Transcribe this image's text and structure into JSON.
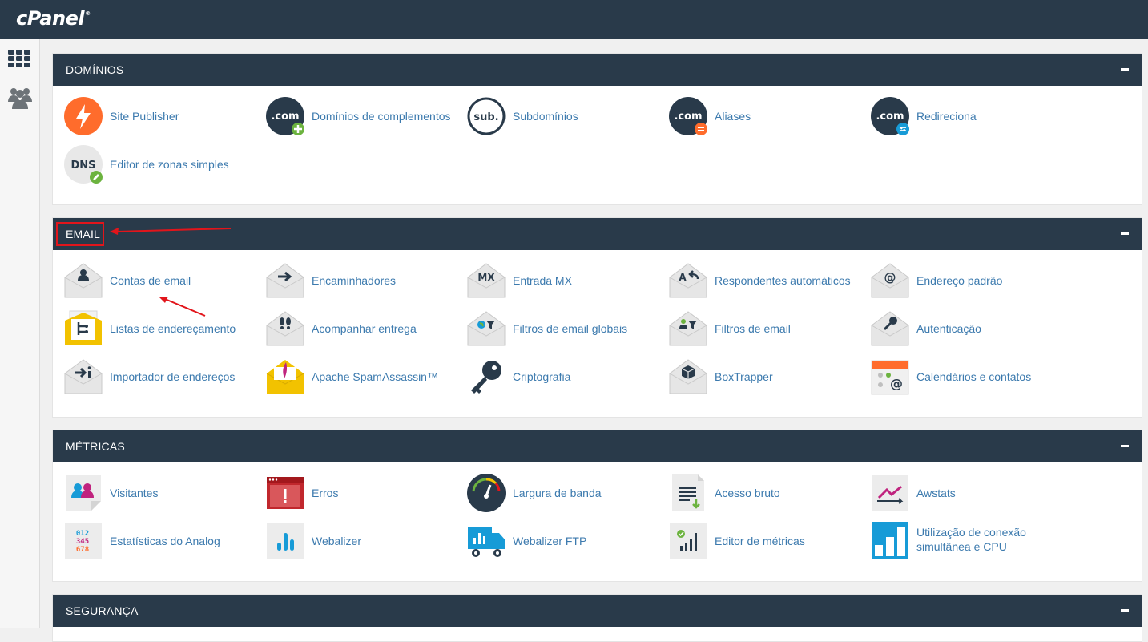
{
  "brand": {
    "logo_text": "cPanel",
    "mark": "®"
  },
  "sidebar": {
    "items": [
      {
        "icon": "grid-icon"
      },
      {
        "icon": "users-icon"
      }
    ]
  },
  "sections": {
    "dominios": {
      "title": "DOMÍNIOS",
      "items": [
        {
          "label": "Site Publisher",
          "icon": "lightning-icon"
        },
        {
          "label": "Domínios de complementos",
          "icon": "dotcom-add-icon"
        },
        {
          "label": "Subdomínios",
          "icon": "subdomain-icon"
        },
        {
          "label": "Aliases",
          "icon": "dotcom-alias-icon"
        },
        {
          "label": "Redireciona",
          "icon": "dotcom-redirect-icon"
        },
        {
          "label": "Editor de zonas simples",
          "icon": "dns-edit-icon"
        }
      ]
    },
    "email": {
      "title": "EMAIL",
      "items": [
        {
          "label": "Contas de email",
          "icon": "envelope-user-icon"
        },
        {
          "label": "Encaminhadores",
          "icon": "envelope-arrow-icon"
        },
        {
          "label": "Entrada MX",
          "icon": "envelope-mx-icon"
        },
        {
          "label": "Respondentes automáticos",
          "icon": "envelope-autoreply-icon"
        },
        {
          "label": "Endereço padrão",
          "icon": "envelope-at-icon"
        },
        {
          "label": "Listas de endereçamento",
          "icon": "mailing-list-icon"
        },
        {
          "label": "Acompanhar entrega",
          "icon": "envelope-footprints-icon"
        },
        {
          "label": "Filtros de email globais",
          "icon": "envelope-global-filter-icon"
        },
        {
          "label": "Filtros de email",
          "icon": "envelope-user-filter-icon"
        },
        {
          "label": "Autenticação",
          "icon": "envelope-key-icon"
        },
        {
          "label": "Importador de endereços",
          "icon": "envelope-import-icon"
        },
        {
          "label": "Apache SpamAssassin™",
          "icon": "spamassassin-icon"
        },
        {
          "label": "Criptografia",
          "icon": "key-icon"
        },
        {
          "label": "BoxTrapper",
          "icon": "envelope-box-icon"
        },
        {
          "label": "Calendários e contatos",
          "icon": "calendar-at-icon"
        }
      ]
    },
    "metricas": {
      "title": "MÉTRICAS",
      "items": [
        {
          "label": "Visitantes",
          "icon": "visitors-icon"
        },
        {
          "label": "Erros",
          "icon": "errors-icon"
        },
        {
          "label": "Largura de banda",
          "icon": "bandwidth-gauge-icon"
        },
        {
          "label": "Acesso bruto",
          "icon": "raw-access-icon"
        },
        {
          "label": "Awstats",
          "icon": "awstats-icon"
        },
        {
          "label": "Estatísticas do Analog",
          "icon": "analog-stats-icon"
        },
        {
          "label": "Webalizer",
          "icon": "webalizer-icon"
        },
        {
          "label": "Webalizer FTP",
          "icon": "webalizer-ftp-icon"
        },
        {
          "label": "Editor de métricas",
          "icon": "metrics-editor-icon"
        },
        {
          "label": "Utilização de conexão simultânea e CPU",
          "icon": "cpu-usage-icon"
        }
      ]
    },
    "seguranca": {
      "title": "SEGURANÇA"
    }
  },
  "colors": {
    "header_bg": "#293a4a",
    "link": "#3c7aae",
    "annotation_red": "#e2151b"
  }
}
